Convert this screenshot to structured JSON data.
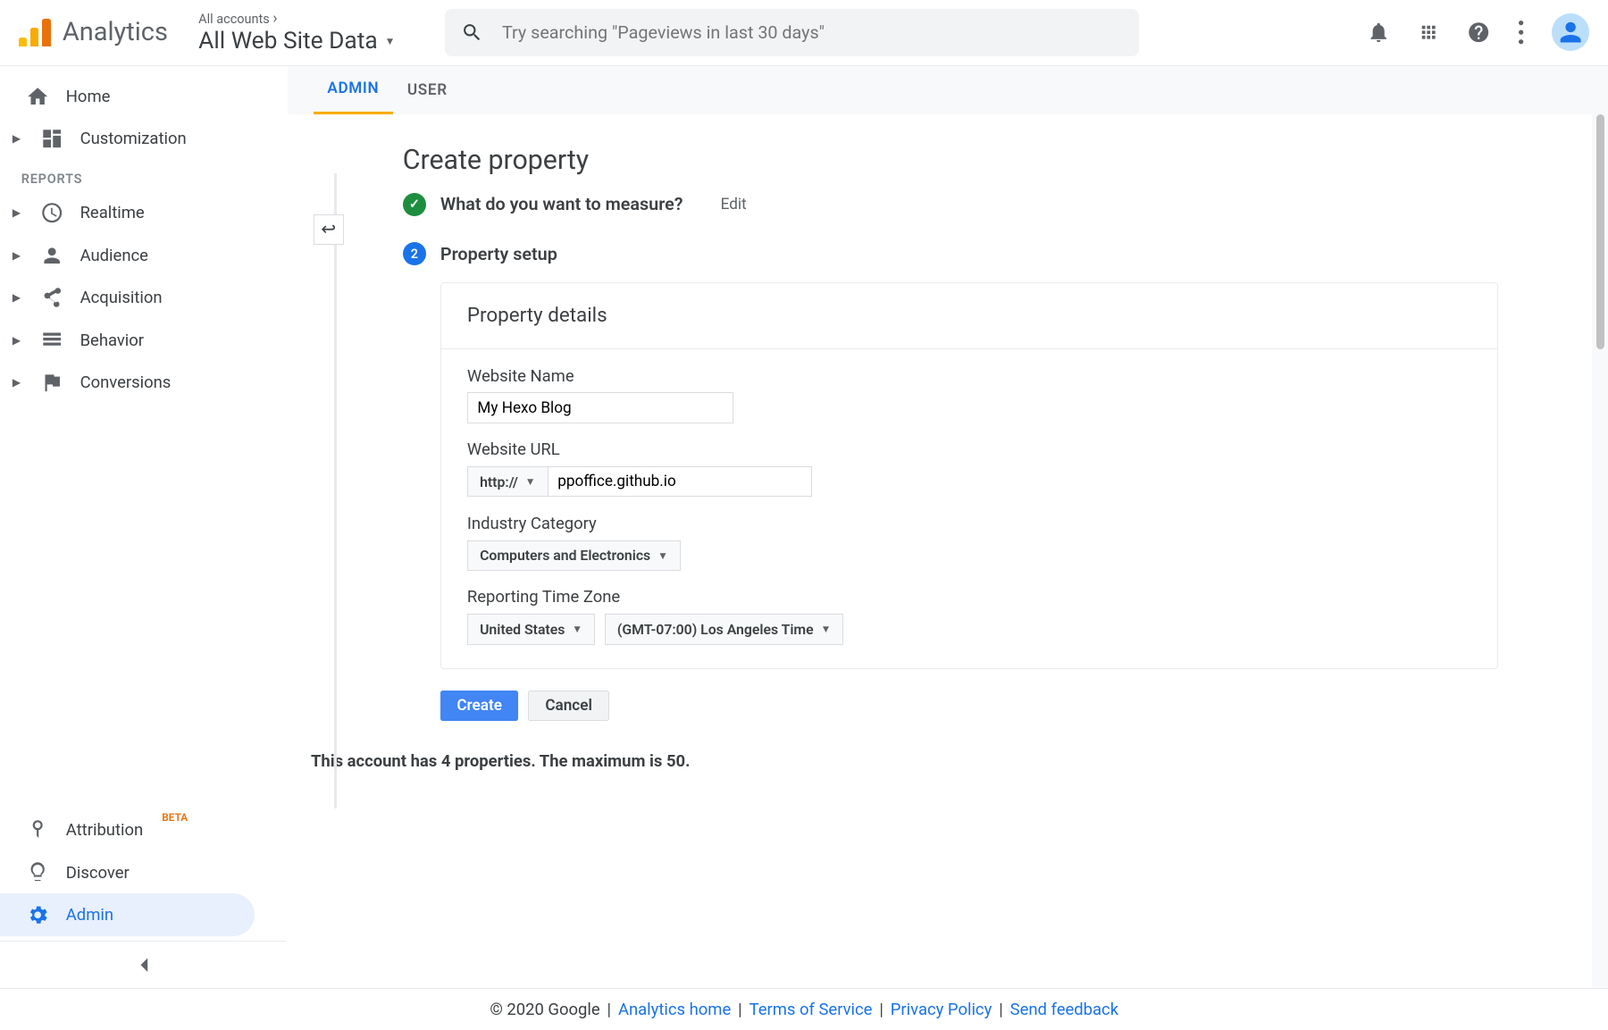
{
  "header": {
    "product": "Analytics",
    "acct_all": "All accounts",
    "acct_name": "All Web Site Data",
    "search_placeholder": "Try searching \"Pageviews in last 30 days\""
  },
  "nav": {
    "home": "Home",
    "customization": "Customization",
    "section_reports": "REPORTS",
    "realtime": "Realtime",
    "audience": "Audience",
    "acquisition": "Acquisition",
    "behavior": "Behavior",
    "conversions": "Conversions",
    "attribution": "Attribution",
    "attribution_beta": "BETA",
    "discover": "Discover",
    "admin": "Admin"
  },
  "tabs": {
    "admin": "ADMIN",
    "user": "USER"
  },
  "page": {
    "title": "Create property",
    "step1_title": "What do you want to measure?",
    "edit": "Edit",
    "step2_num": "2",
    "step2_title": "Property setup",
    "card_title": "Property details",
    "website_name_label": "Website Name",
    "website_name_value": "My Hexo Blog",
    "website_url_label": "Website URL",
    "protocol": "http://",
    "website_url_value": "ppoffice.github.io",
    "industry_label": "Industry Category",
    "industry_value": "Computers and Electronics",
    "timezone_label": "Reporting Time Zone",
    "tz_country": "United States",
    "tz_value": "(GMT-07:00) Los Angeles Time",
    "create": "Create",
    "cancel": "Cancel",
    "limit": "This account has 4 properties. The maximum is 50."
  },
  "footer": {
    "copyright": "© 2020 Google",
    "home": "Analytics home",
    "tos": "Terms of Service",
    "privacy": "Privacy Policy",
    "feedback": "Send feedback"
  }
}
